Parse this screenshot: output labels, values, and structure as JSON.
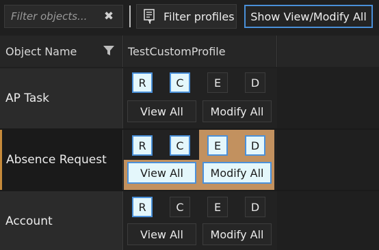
{
  "toolbar": {
    "filter_placeholder": "Filter objects...",
    "clear_icon": "close-icon",
    "filter_profiles_label": "Filter profiles",
    "filter_profiles_icon": "filter-list-icon",
    "show_view_modify_label": "Show View/Modify All"
  },
  "grid": {
    "headers": {
      "object_name": "Object Name",
      "profile": "TestCustomProfile",
      "filter_icon": "funnel-icon"
    },
    "rows": [
      {
        "name": "AP Task",
        "selected": false,
        "perms": {
          "R": true,
          "C": true,
          "E": false,
          "D": false
        },
        "view_all": {
          "label": "View All",
          "on": false
        },
        "modify_all": {
          "label": "Modify All",
          "on": false
        }
      },
      {
        "name": "Absence Request",
        "selected": true,
        "perms": {
          "R": true,
          "C": true,
          "E": true,
          "D": true
        },
        "view_all": {
          "label": "View All",
          "on": true
        },
        "modify_all": {
          "label": "Modify All",
          "on": true
        }
      },
      {
        "name": "Account",
        "selected": false,
        "perms": {
          "R": true,
          "C": false,
          "E": false,
          "D": false
        },
        "view_all": {
          "label": "View All",
          "on": false
        },
        "modify_all": {
          "label": "Modify All",
          "on": false
        }
      }
    ],
    "perm_labels": {
      "R": "R",
      "C": "C",
      "E": "E",
      "D": "D"
    }
  },
  "colors": {
    "background": "#1f1f1f",
    "accent_border": "#4a90d9",
    "toggle_on_fill": "#e4f7fb",
    "highlight": "#c2915f",
    "selected_marker": "#c58a3a"
  }
}
